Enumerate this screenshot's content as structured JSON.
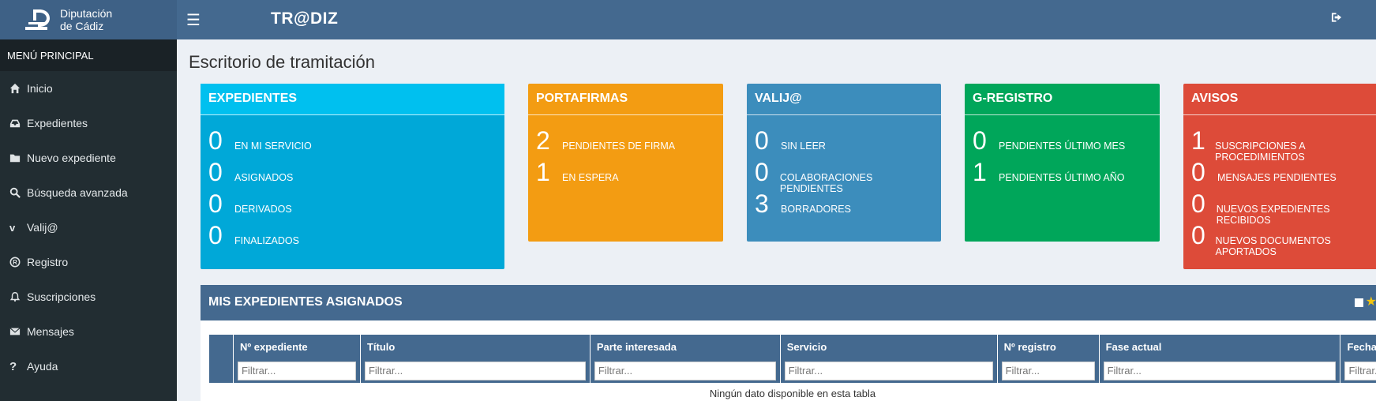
{
  "header": {
    "logo_line1": "Diputación",
    "logo_line2": "de Cádiz",
    "brand": "TR@DIZ",
    "menu_icon": "hamburger-icon",
    "logout_icon": "sign-out-icon"
  },
  "sidebar": {
    "title": "MENÚ PRINCIPAL",
    "items": [
      {
        "label": "Inicio",
        "icon": "home-icon"
      },
      {
        "label": "Expedientes",
        "icon": "inbox-icon"
      },
      {
        "label": "Nuevo expediente",
        "icon": "folder-icon"
      },
      {
        "label": "Búsqueda avanzada",
        "icon": "search-icon"
      },
      {
        "label": "Valij@",
        "icon": "vimeo-icon"
      },
      {
        "label": "Registro",
        "icon": "registered-icon"
      },
      {
        "label": "Suscripciones",
        "icon": "bell-icon"
      },
      {
        "label": "Mensajes",
        "icon": "envelope-icon"
      },
      {
        "label": "Ayuda",
        "icon": "question-icon"
      }
    ]
  },
  "page": {
    "title": "Escritorio de tramitación"
  },
  "boxes": {
    "expedientes": {
      "title": "EXPEDIENTES",
      "stats": [
        {
          "num": "0",
          "label": "EN MI SERVICIO"
        },
        {
          "num": "0",
          "label": "ASIGNADOS"
        },
        {
          "num": "0",
          "label": "DERIVADOS"
        },
        {
          "num": "0",
          "label": "FINALIZADOS"
        }
      ]
    },
    "portafirmas": {
      "title": "PORTAFIRMAS",
      "stats": [
        {
          "num": "2",
          "label": "PENDIENTES DE FIRMA"
        },
        {
          "num": "1",
          "label": "EN ESPERA"
        }
      ]
    },
    "valija": {
      "title": "VALIJ@",
      "stats": [
        {
          "num": "0",
          "label": "SIN LEER"
        },
        {
          "num": "0",
          "label": "COLABORACIONES PENDIENTES"
        },
        {
          "num": "3",
          "label": "BORRADORES"
        }
      ]
    },
    "gregistro": {
      "title": "G-REGISTRO",
      "stats": [
        {
          "num": "0",
          "label": "PENDIENTES ÚLTIMO MES"
        },
        {
          "num": "1",
          "label": "PENDIENTES ÚLTIMO AÑO"
        }
      ]
    },
    "avisos": {
      "title": "AVISOS",
      "stats": [
        {
          "num": "1",
          "label": "SUSCRIPCIONES A PROCEDIMIENTOS"
        },
        {
          "num": "0",
          "label": "MENSAJES PENDIENTES"
        },
        {
          "num": "0",
          "label": "NUEVOS EXPEDIENTES RECIBIDOS"
        },
        {
          "num": "0",
          "label": "NUEVOS DOCUMENTOS APORTADOS"
        }
      ]
    }
  },
  "assigned": {
    "title": "MIS EXPEDIENTES ASIGNADOS",
    "columns": [
      "",
      "Nº expediente",
      "Título",
      "Parte interesada",
      "Servicio",
      "Nº registro",
      "Fase actual",
      "Fecha"
    ],
    "filter_placeholder": "Filtrar...",
    "empty_text": "Ningún dato disponible en esta tabla"
  }
}
